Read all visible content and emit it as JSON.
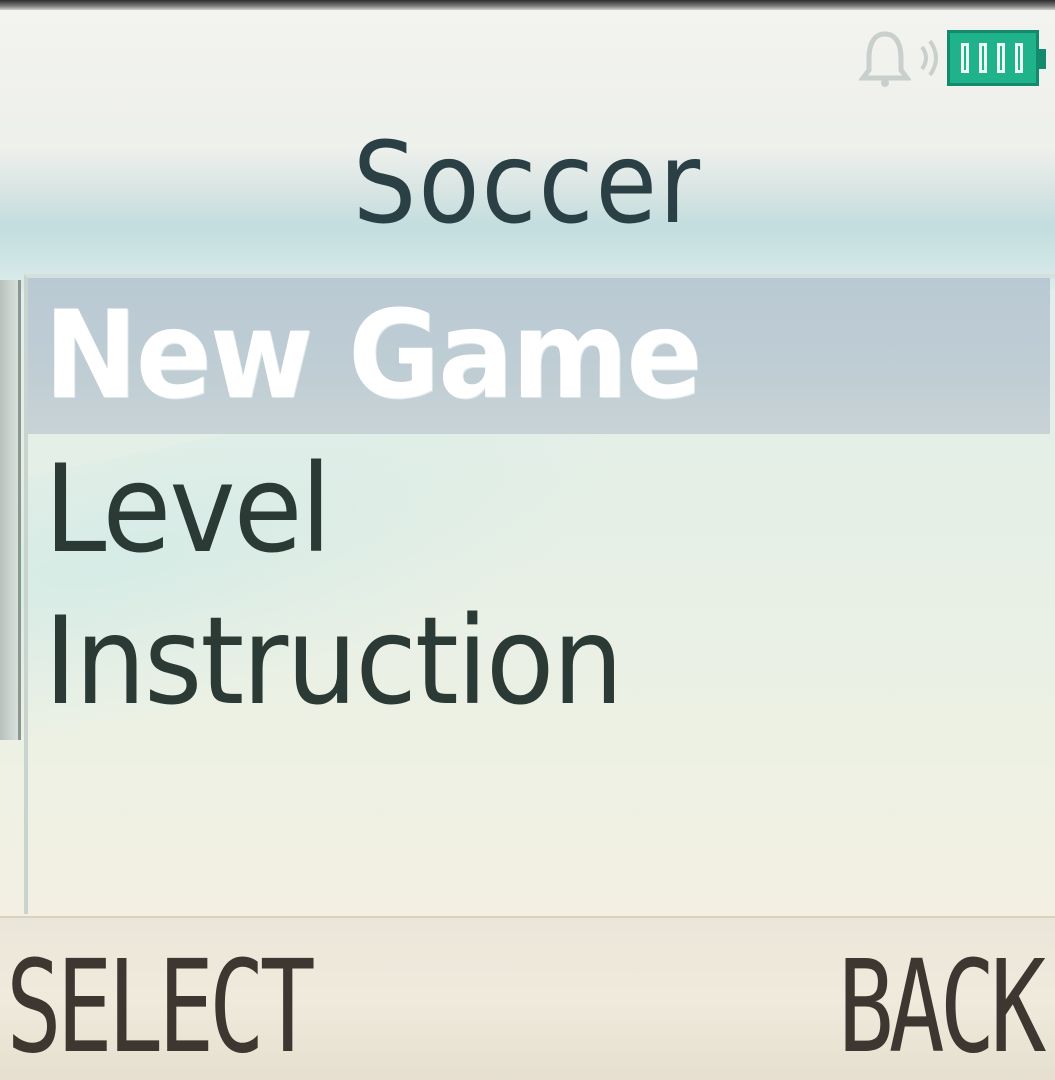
{
  "screen": {
    "title": "Soccer"
  },
  "status_bar": {
    "icons": [
      "bell-icon",
      "sound-icon",
      "battery-icon"
    ],
    "battery_color": "#1fb28b"
  },
  "menu": {
    "items": [
      {
        "label": "New Game",
        "selected": true
      },
      {
        "label": "Level",
        "selected": false
      },
      {
        "label": "Instruction",
        "selected": false
      }
    ],
    "highlight_color": "#bccbd3"
  },
  "softkeys": {
    "left": "SELECT",
    "right": "BACK"
  }
}
